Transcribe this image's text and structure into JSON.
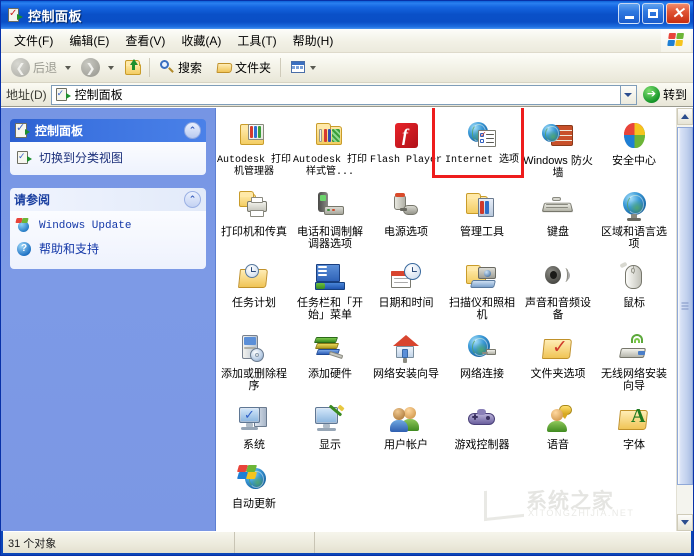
{
  "window": {
    "title": "控制面板",
    "title_icon": "control-panel-icon",
    "buttons": {
      "minimize": "_",
      "maximize": "□",
      "close": "✕"
    }
  },
  "menubar": {
    "items": [
      {
        "label": "文件(F)",
        "name": "menu-file"
      },
      {
        "label": "编辑(E)",
        "name": "menu-edit"
      },
      {
        "label": "查看(V)",
        "name": "menu-view"
      },
      {
        "label": "收藏(A)",
        "name": "menu-favorites"
      },
      {
        "label": "工具(T)",
        "name": "menu-tools"
      },
      {
        "label": "帮助(H)",
        "name": "menu-help"
      }
    ],
    "logo": "windows-logo-icon"
  },
  "toolbar": {
    "back_label": "后退",
    "forward_label": "",
    "up_label": "",
    "search_label": "搜索",
    "folders_label": "文件夹",
    "views_label": ""
  },
  "address": {
    "label": "地址(D)",
    "value": "控制面板",
    "go_label": "转到",
    "go_glyph": "➔"
  },
  "sidebar": {
    "panels": [
      {
        "name": "control-panel-panel",
        "title": "控制面板",
        "style": "blue",
        "chevron": "⌃",
        "links": [
          {
            "label": "切换到分类视图",
            "icon": "switch-view-icon",
            "name": "sidebar-link-switch-view"
          }
        ]
      },
      {
        "name": "see-also-panel",
        "title": "请参阅",
        "style": "white",
        "chevron": "⌃",
        "links": [
          {
            "label": "Windows Update",
            "icon": "windows-update-icon",
            "name": "sidebar-link-windows-update"
          },
          {
            "label": "帮助和支持",
            "icon": "help-support-icon",
            "name": "sidebar-link-help-support"
          }
        ]
      }
    ]
  },
  "content": {
    "highlighted_item": "Internet 选项",
    "rows": [
      [
        {
          "label": "Autodesk 打印机管理器",
          "icon": "autodesk-printer-manager-icon",
          "mono": true
        },
        {
          "label": "Autodesk 打印样式管...",
          "icon": "autodesk-plot-style-icon",
          "mono": true
        },
        {
          "label": "Flash Player",
          "icon": "flash-player-icon",
          "mono": true
        },
        {
          "label": "Internet 选项",
          "icon": "internet-options-icon",
          "mono": true
        },
        {
          "label": "Windows 防火墙",
          "icon": "windows-firewall-icon",
          "mono": false
        },
        {
          "label": "安全中心",
          "icon": "security-center-icon",
          "mono": false
        }
      ],
      [
        {
          "label": "打印机和传真",
          "icon": "printers-and-faxes-icon",
          "mono": false
        },
        {
          "label": "电话和调制解调器选项",
          "icon": "phone-and-modem-icon",
          "mono": false
        },
        {
          "label": "电源选项",
          "icon": "power-options-icon",
          "mono": false
        },
        {
          "label": "管理工具",
          "icon": "administrative-tools-icon",
          "mono": false
        },
        {
          "label": "键盘",
          "icon": "keyboard-icon",
          "mono": false
        },
        {
          "label": "区域和语言选项",
          "icon": "regional-language-icon",
          "mono": false
        }
      ],
      [
        {
          "label": "任务计划",
          "icon": "scheduled-tasks-icon",
          "mono": false
        },
        {
          "label": "任务栏和「开始」菜单",
          "icon": "taskbar-startmenu-icon",
          "mono": false
        },
        {
          "label": "日期和时间",
          "icon": "date-and-time-icon",
          "mono": false
        },
        {
          "label": "扫描仪和照相机",
          "icon": "scanners-and-cameras-icon",
          "mono": false
        },
        {
          "label": "声音和音频设备",
          "icon": "sounds-audio-devices-icon",
          "mono": false
        },
        {
          "label": "鼠标",
          "icon": "mouse-icon",
          "mono": false
        }
      ],
      [
        {
          "label": "添加或删除程序",
          "icon": "add-remove-programs-icon",
          "mono": false
        },
        {
          "label": "添加硬件",
          "icon": "add-hardware-icon",
          "mono": false
        },
        {
          "label": "网络安装向导",
          "icon": "network-setup-wizard-icon",
          "mono": false
        },
        {
          "label": "网络连接",
          "icon": "network-connections-icon",
          "mono": false
        },
        {
          "label": "文件夹选项",
          "icon": "folder-options-icon",
          "mono": false
        },
        {
          "label": "无线网络安装向导",
          "icon": "wireless-network-wizard-icon",
          "mono": false
        }
      ],
      [
        {
          "label": "系统",
          "icon": "system-icon",
          "mono": false
        },
        {
          "label": "显示",
          "icon": "display-icon",
          "mono": false
        },
        {
          "label": "用户帐户",
          "icon": "user-accounts-icon",
          "mono": false
        },
        {
          "label": "游戏控制器",
          "icon": "game-controllers-icon",
          "mono": false
        },
        {
          "label": "语音",
          "icon": "speech-icon",
          "mono": false
        },
        {
          "label": "字体",
          "icon": "fonts-icon",
          "mono": false
        }
      ],
      [
        {
          "label": "自动更新",
          "icon": "automatic-updates-icon",
          "mono": false
        }
      ]
    ]
  },
  "watermark": {
    "text": "系统之家",
    "subtext": "XITONGZHIJIA.NET"
  },
  "statusbar": {
    "object_count": "31 个对象"
  },
  "colors": {
    "titlebar_blue": "#0a50c8",
    "sidebar_blue": "#7b97e4",
    "panel_header_blue": "#3c73e0",
    "highlight_red": "#ee1c1c",
    "link_blue": "#1b2f7a",
    "content_bg": "#ffffff"
  }
}
